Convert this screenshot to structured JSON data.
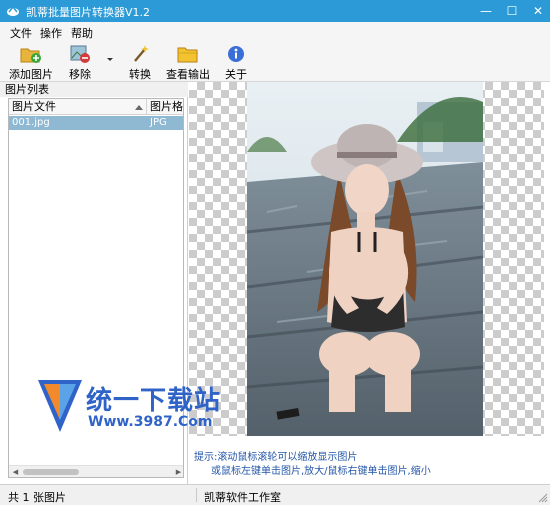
{
  "window": {
    "title": "凯蒂批量图片转换器V1.2",
    "min_icon": "—",
    "max_icon": "☐",
    "close_icon": "✕"
  },
  "menu": [
    "文件",
    "操作",
    "帮助"
  ],
  "toolbar": {
    "add": "添加图片",
    "remove": "移除",
    "convert": "转换",
    "view_output": "查看输出",
    "about": "关于"
  },
  "left_pane": {
    "title": "图片列表",
    "columns": [
      "图片文件",
      "图片格式"
    ],
    "rows": [
      {
        "file": "001.jpg",
        "format": "JPG"
      }
    ]
  },
  "hint": {
    "line1": "提示:滚动鼠标滚轮可以缩放显示图片",
    "line2": "或鼠标左键单击图片,放大/鼠标右键单击图片,缩小"
  },
  "watermark": {
    "name": "统一下载站",
    "url": "Www.3987.Com"
  },
  "status": {
    "count": "共 1 张图片",
    "studio": "凯蒂软件工作室"
  },
  "colors": {
    "titlebar": "#2b9ad6",
    "selection": "#8fb8d3",
    "hint_text": "#2456a8",
    "watermark": "#2f63c8"
  }
}
